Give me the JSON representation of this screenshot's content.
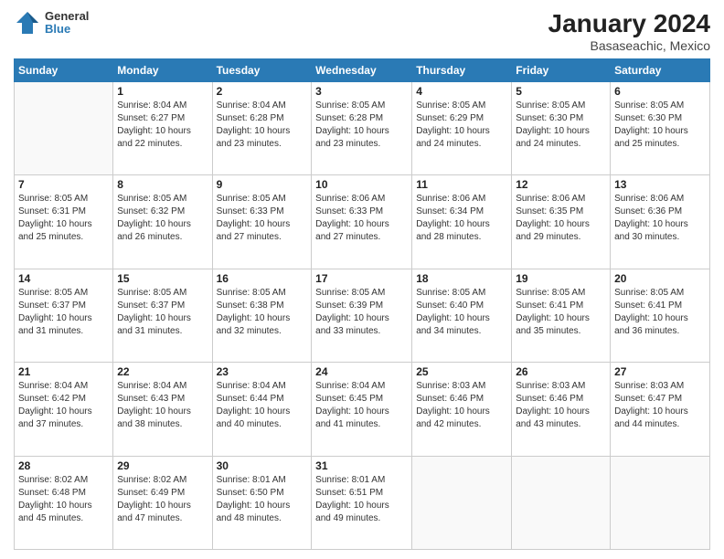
{
  "header": {
    "logo": {
      "line1": "General",
      "line2": "Blue"
    },
    "title": "January 2024",
    "subtitle": "Basaseachic, Mexico"
  },
  "weekdays": [
    "Sunday",
    "Monday",
    "Tuesday",
    "Wednesday",
    "Thursday",
    "Friday",
    "Saturday"
  ],
  "weeks": [
    [
      {
        "day": "",
        "info": ""
      },
      {
        "day": "1",
        "info": "Sunrise: 8:04 AM\nSunset: 6:27 PM\nDaylight: 10 hours\nand 22 minutes."
      },
      {
        "day": "2",
        "info": "Sunrise: 8:04 AM\nSunset: 6:28 PM\nDaylight: 10 hours\nand 23 minutes."
      },
      {
        "day": "3",
        "info": "Sunrise: 8:05 AM\nSunset: 6:28 PM\nDaylight: 10 hours\nand 23 minutes."
      },
      {
        "day": "4",
        "info": "Sunrise: 8:05 AM\nSunset: 6:29 PM\nDaylight: 10 hours\nand 24 minutes."
      },
      {
        "day": "5",
        "info": "Sunrise: 8:05 AM\nSunset: 6:30 PM\nDaylight: 10 hours\nand 24 minutes."
      },
      {
        "day": "6",
        "info": "Sunrise: 8:05 AM\nSunset: 6:30 PM\nDaylight: 10 hours\nand 25 minutes."
      }
    ],
    [
      {
        "day": "7",
        "info": "Sunrise: 8:05 AM\nSunset: 6:31 PM\nDaylight: 10 hours\nand 25 minutes."
      },
      {
        "day": "8",
        "info": "Sunrise: 8:05 AM\nSunset: 6:32 PM\nDaylight: 10 hours\nand 26 minutes."
      },
      {
        "day": "9",
        "info": "Sunrise: 8:05 AM\nSunset: 6:33 PM\nDaylight: 10 hours\nand 27 minutes."
      },
      {
        "day": "10",
        "info": "Sunrise: 8:06 AM\nSunset: 6:33 PM\nDaylight: 10 hours\nand 27 minutes."
      },
      {
        "day": "11",
        "info": "Sunrise: 8:06 AM\nSunset: 6:34 PM\nDaylight: 10 hours\nand 28 minutes."
      },
      {
        "day": "12",
        "info": "Sunrise: 8:06 AM\nSunset: 6:35 PM\nDaylight: 10 hours\nand 29 minutes."
      },
      {
        "day": "13",
        "info": "Sunrise: 8:06 AM\nSunset: 6:36 PM\nDaylight: 10 hours\nand 30 minutes."
      }
    ],
    [
      {
        "day": "14",
        "info": "Sunrise: 8:05 AM\nSunset: 6:37 PM\nDaylight: 10 hours\nand 31 minutes."
      },
      {
        "day": "15",
        "info": "Sunrise: 8:05 AM\nSunset: 6:37 PM\nDaylight: 10 hours\nand 31 minutes."
      },
      {
        "day": "16",
        "info": "Sunrise: 8:05 AM\nSunset: 6:38 PM\nDaylight: 10 hours\nand 32 minutes."
      },
      {
        "day": "17",
        "info": "Sunrise: 8:05 AM\nSunset: 6:39 PM\nDaylight: 10 hours\nand 33 minutes."
      },
      {
        "day": "18",
        "info": "Sunrise: 8:05 AM\nSunset: 6:40 PM\nDaylight: 10 hours\nand 34 minutes."
      },
      {
        "day": "19",
        "info": "Sunrise: 8:05 AM\nSunset: 6:41 PM\nDaylight: 10 hours\nand 35 minutes."
      },
      {
        "day": "20",
        "info": "Sunrise: 8:05 AM\nSunset: 6:41 PM\nDaylight: 10 hours\nand 36 minutes."
      }
    ],
    [
      {
        "day": "21",
        "info": "Sunrise: 8:04 AM\nSunset: 6:42 PM\nDaylight: 10 hours\nand 37 minutes."
      },
      {
        "day": "22",
        "info": "Sunrise: 8:04 AM\nSunset: 6:43 PM\nDaylight: 10 hours\nand 38 minutes."
      },
      {
        "day": "23",
        "info": "Sunrise: 8:04 AM\nSunset: 6:44 PM\nDaylight: 10 hours\nand 40 minutes."
      },
      {
        "day": "24",
        "info": "Sunrise: 8:04 AM\nSunset: 6:45 PM\nDaylight: 10 hours\nand 41 minutes."
      },
      {
        "day": "25",
        "info": "Sunrise: 8:03 AM\nSunset: 6:46 PM\nDaylight: 10 hours\nand 42 minutes."
      },
      {
        "day": "26",
        "info": "Sunrise: 8:03 AM\nSunset: 6:46 PM\nDaylight: 10 hours\nand 43 minutes."
      },
      {
        "day": "27",
        "info": "Sunrise: 8:03 AM\nSunset: 6:47 PM\nDaylight: 10 hours\nand 44 minutes."
      }
    ],
    [
      {
        "day": "28",
        "info": "Sunrise: 8:02 AM\nSunset: 6:48 PM\nDaylight: 10 hours\nand 45 minutes."
      },
      {
        "day": "29",
        "info": "Sunrise: 8:02 AM\nSunset: 6:49 PM\nDaylight: 10 hours\nand 47 minutes."
      },
      {
        "day": "30",
        "info": "Sunrise: 8:01 AM\nSunset: 6:50 PM\nDaylight: 10 hours\nand 48 minutes."
      },
      {
        "day": "31",
        "info": "Sunrise: 8:01 AM\nSunset: 6:51 PM\nDaylight: 10 hours\nand 49 minutes."
      },
      {
        "day": "",
        "info": ""
      },
      {
        "day": "",
        "info": ""
      },
      {
        "day": "",
        "info": ""
      }
    ]
  ]
}
